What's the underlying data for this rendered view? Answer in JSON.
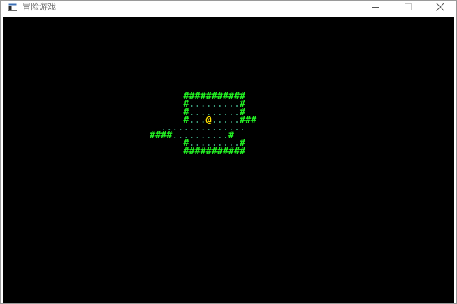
{
  "window": {
    "title": "冒险游戏",
    "controls": [
      "minimize",
      "maximize",
      "close"
    ]
  },
  "game": {
    "map_rows": [
      "                                 ",
      "      ###########      ",
      "      #.........#      ",
      "      #.........#      ",
      "      #...@.....###    ",
      "  ...............     ",
      "####..........#       ",
      "      #.........#      ",
      "      ###########      "
    ],
    "legend": {
      "#": "wall",
      ".": "floor",
      "@": "player"
    },
    "colors": {
      "background": "#000000",
      "wall": "#22ee22",
      "floor": "#3a9a7a",
      "player": "#ffe000"
    }
  }
}
